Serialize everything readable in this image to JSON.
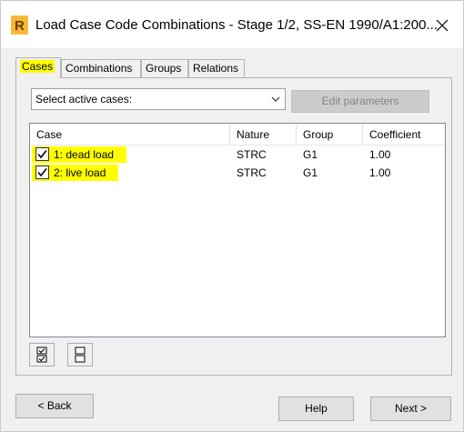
{
  "window": {
    "title": "Load Case Code Combinations - Stage 1/2, SS-EN 1990/A1:200..."
  },
  "tabs": [
    {
      "label": "Cases",
      "active": true
    },
    {
      "label": "Combinations",
      "active": false
    },
    {
      "label": "Groups",
      "active": false
    },
    {
      "label": "Relations",
      "active": false
    }
  ],
  "toolbar": {
    "select_value": "Select active cases:",
    "edit_params_label": "Edit parameters"
  },
  "list": {
    "columns": [
      "Case",
      "Nature",
      "Group",
      "Coefficient"
    ],
    "rows": [
      {
        "case": "1: dead load",
        "nature": "STRC",
        "group": "G1",
        "coefficient": "1.00",
        "checked": true
      },
      {
        "case": "2: live load",
        "nature": "STRC",
        "group": "G1",
        "coefficient": "1.00",
        "checked": true
      }
    ]
  },
  "footer": {
    "back_label": "< Back",
    "help_label": "Help",
    "next_label": "Next >"
  },
  "colors": {
    "highlight": "#ffff00",
    "window_bg": "#f0f0f0",
    "app_icon": "#f5a623"
  },
  "icons": [
    "app-icon",
    "close-icon",
    "chevron-down-icon",
    "check-all-icon",
    "uncheck-all-icon"
  ]
}
